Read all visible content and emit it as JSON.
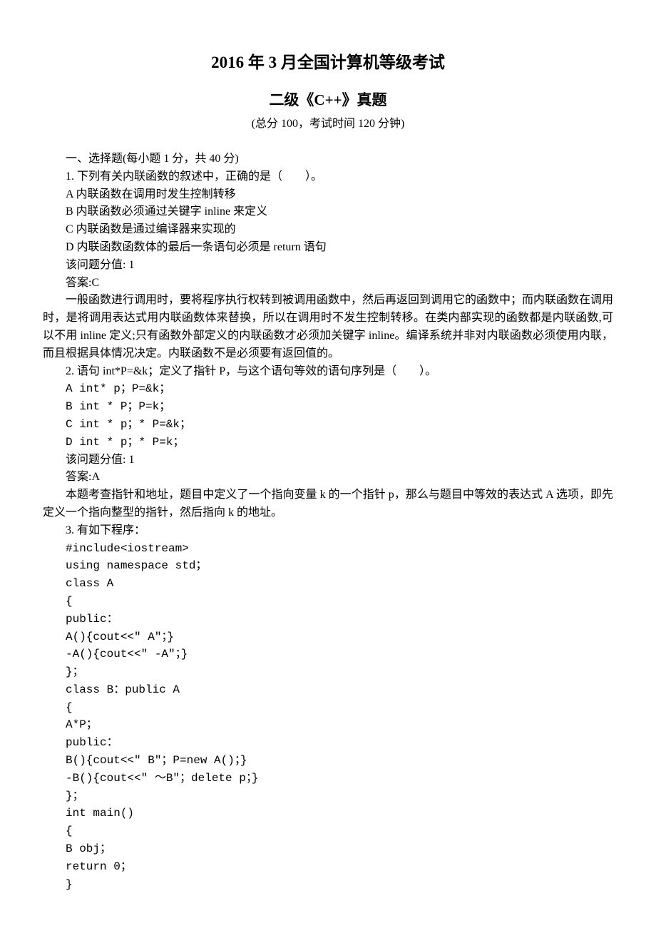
{
  "title_main": "2016 年 3 月全国计算机等级考试",
  "title_sub": "二级《C++》真题",
  "title_meta": "(总分 100，考试时间 120 分钟)",
  "section_heading": "一、选择题(每小题 1 分，共 40 分)",
  "q1": {
    "stem": "1. 下列有关内联函数的叙述中，正确的是（　　）。",
    "A": "A 内联函数在调用时发生控制转移",
    "B": "B 内联函数必须通过关键字 inline 来定义",
    "C": "C 内联函数是通过编译器来实现的",
    "D": "D 内联函数函数体的最后一条语句必须是 return 语句",
    "score": "该问题分值: 1",
    "answer": "答案:C",
    "explain": "一般函数进行调用时，要将程序执行权转到被调用函数中，然后再返回到调用它的函数中；而内联函数在调用时，是将调用表达式用内联函数体来替换，所以在调用时不发生控制转移。在类内部实现的函数都是内联函数,可以不用 inline 定义;只有函数外部定义的内联函数才必须加关键字 inline。编译系统并非对内联函数必须使用内联，而且根据具体情况决定。内联函数不是必须要有返回值的。"
  },
  "q2": {
    "stem": "2. 语句 int*P=&k；定义了指针 P，与这个语句等效的语句序列是（　　）。",
    "A": "A int* p；P=&k；",
    "B": "B int * P；P=k；",
    "C": "C int * p；* P=&k；",
    "D": "D int * p；* P=k；",
    "score": "该问题分值: 1",
    "answer": "答案:A",
    "explain": "本题考查指针和地址，题目中定义了一个指向变量 k 的一个指针 p，那么与题目中等效的表达式 A 选项，即先定义一个指向整型的指针，然后指向 k 的地址。"
  },
  "q3": {
    "stem": "3. 有如下程序：",
    "code": [
      "#include<iostream>",
      "using namespace std；",
      "class A",
      "{",
      "public：",
      "A(){cout<<\" A\"；}",
      "-A(){cout<<\" -A\"；}",
      "}；",
      "class B：public A",
      "{",
      "A*P；",
      "public：",
      "B(){cout<<\" B\"；P=new A()；}",
      "-B(){cout<<\" ～B\"；delete p；}",
      "}；",
      "int main()",
      "{",
      "B obj；",
      "return 0；",
      "}"
    ]
  }
}
